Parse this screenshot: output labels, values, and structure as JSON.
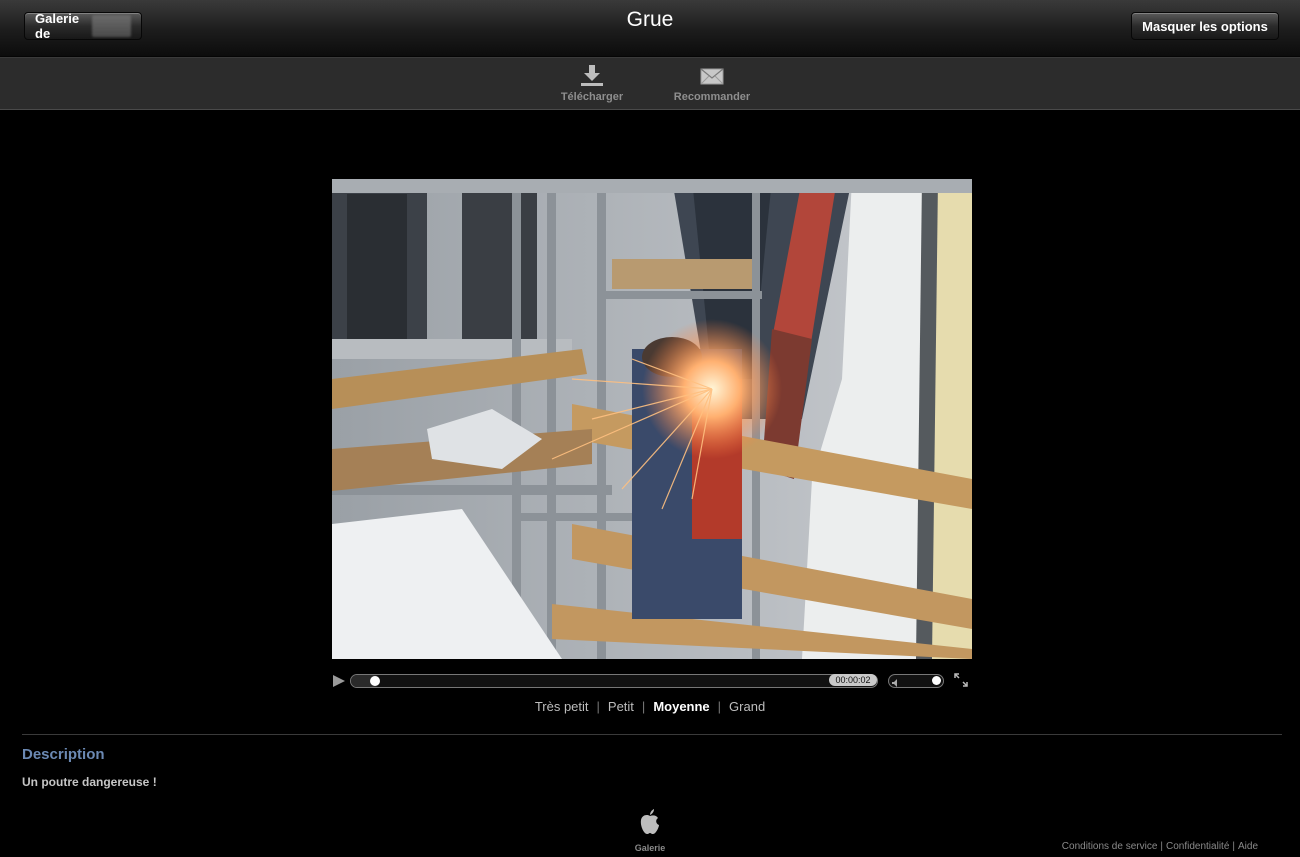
{
  "header": {
    "gallery_button": "Galerie de",
    "title": "Grue",
    "options_button": "Masquer les options"
  },
  "toolbar": {
    "download": {
      "label": "Télécharger",
      "icon": "download-icon"
    },
    "recommend": {
      "label": "Recommander",
      "icon": "envelope-icon"
    }
  },
  "player": {
    "timecode": "00:00:02",
    "progress_fraction": 0.04,
    "volume_fraction": 0.9
  },
  "sizes": {
    "options": [
      "Très petit",
      "Petit",
      "Moyenne",
      "Grand"
    ],
    "selected": "Moyenne"
  },
  "description": {
    "heading": "Description",
    "text": "Un poutre dangereuse !"
  },
  "footer": {
    "logo_label": "Galerie",
    "links": [
      "Conditions de service",
      "Confidentialité",
      "Aide"
    ]
  },
  "colors": {
    "background": "#000000",
    "description_heading": "#6b89b3",
    "toolbar": "#2c2c2c"
  }
}
